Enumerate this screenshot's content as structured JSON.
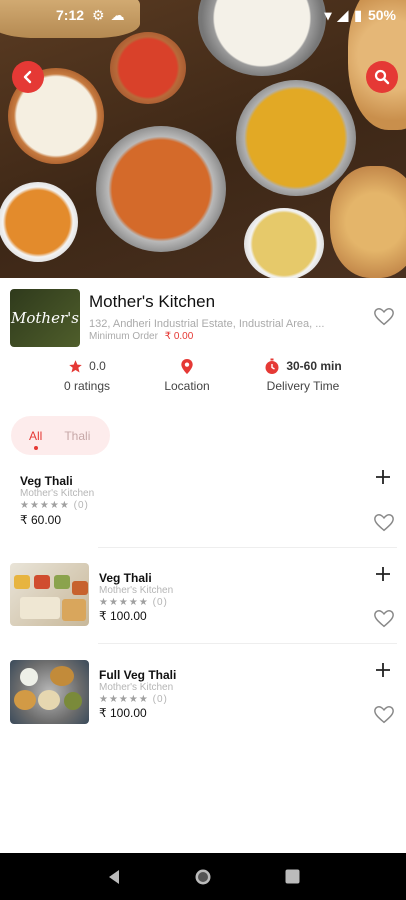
{
  "status_bar": {
    "time": "7:12",
    "battery": "50%"
  },
  "restaurant": {
    "name": "Mother's Kitchen",
    "logo_text": "Mother's",
    "address": "132, Andheri Industrial Estate, Industrial Area, ...",
    "min_order_label": "Minimum Order",
    "min_order_value": "₹ 0.00"
  },
  "stats": {
    "rating_value": "0.0",
    "rating_label": "0 ratings",
    "location_label": "Location",
    "delivery_time": "30-60 min",
    "delivery_label": "Delivery Time"
  },
  "tabs": [
    {
      "label": "All",
      "active": true
    },
    {
      "label": "Thali",
      "active": false
    }
  ],
  "menu_items": [
    {
      "name": "Veg Thali",
      "restaurant": "Mother's Kitchen",
      "stars": "★★★★★",
      "rating_count": "(0)",
      "price": "₹ 60.00"
    },
    {
      "name": "Veg Thali",
      "restaurant": "Mother's Kitchen",
      "stars": "★★★★★",
      "rating_count": "(0)",
      "price": "₹ 100.00"
    },
    {
      "name": "Full Veg Thali",
      "restaurant": "Mother's Kitchen",
      "stars": "★★★★★",
      "rating_count": "(0)",
      "price": "₹ 100.00"
    }
  ],
  "colors": {
    "accent": "#e53935",
    "tab_background": "#fdecec"
  },
  "icons": [
    "back-arrow-icon",
    "search-icon",
    "star-icon",
    "location-pin-icon",
    "timer-icon",
    "heart-icon",
    "plus-icon"
  ]
}
